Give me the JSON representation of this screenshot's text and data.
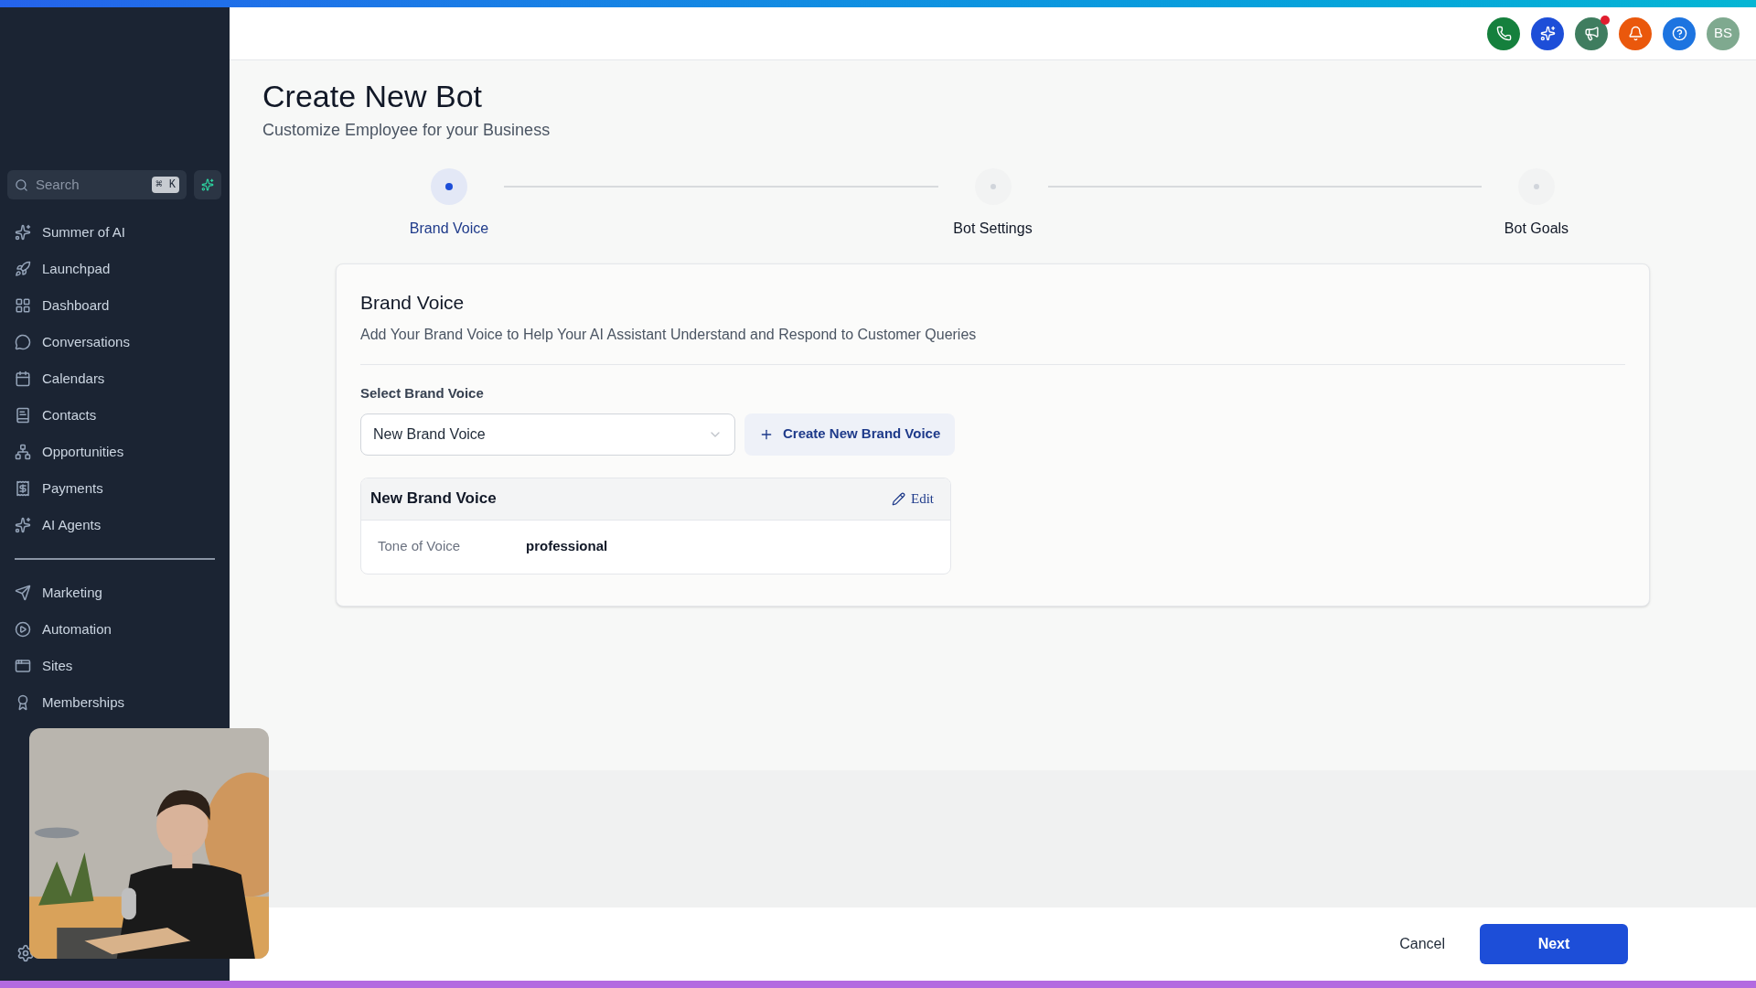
{
  "sidebar": {
    "search": {
      "placeholder": "Search",
      "shortcut": "⌘ K"
    },
    "items": [
      {
        "label": "Summer of AI",
        "kind": "sparkle"
      },
      {
        "label": "Launchpad",
        "kind": "rocket"
      },
      {
        "label": "Dashboard",
        "kind": "grid"
      },
      {
        "label": "Conversations",
        "kind": "chat"
      },
      {
        "label": "Calendars",
        "kind": "calendar"
      },
      {
        "label": "Contacts",
        "kind": "book"
      },
      {
        "label": "Opportunities",
        "kind": "network"
      },
      {
        "label": "Payments",
        "kind": "receipt"
      },
      {
        "label": "AI Agents",
        "kind": "sparkle"
      }
    ],
    "items_lower": [
      {
        "label": "Marketing",
        "kind": "send"
      },
      {
        "label": "Automation",
        "kind": "play"
      },
      {
        "label": "Sites",
        "kind": "site"
      },
      {
        "label": "Memberships",
        "kind": "award"
      }
    ]
  },
  "header": {
    "buttons": [
      {
        "kind": "phone",
        "color": "#15803d",
        "dot": false
      },
      {
        "kind": "sparkles",
        "color": "#1d4ed8",
        "dot": false
      },
      {
        "kind": "megaphone",
        "color": "#3f7d5f",
        "dot": true
      },
      {
        "kind": "bell",
        "color": "#ea580c",
        "dot": false
      },
      {
        "kind": "help",
        "color": "#1d74e0",
        "dot": false
      }
    ],
    "avatar": "BS"
  },
  "page": {
    "title": "Create New Bot",
    "subtitle": "Customize Employee for your Business"
  },
  "steps": [
    {
      "label": "Brand Voice",
      "selected": true
    },
    {
      "label": "Bot Settings",
      "selected": false
    },
    {
      "label": "Bot Goals",
      "selected": false
    }
  ],
  "card": {
    "title": "Brand Voice",
    "description": "Add Your Brand Voice to Help Your AI Assistant Understand and Respond to Customer Queries",
    "select_label": "Select Brand Voice",
    "select_value": "New Brand Voice",
    "create_button": "Create New Brand Voice",
    "voice": {
      "name": "New Brand Voice",
      "edit": "Edit",
      "fields": [
        {
          "label": "Tone of Voice",
          "value": "professional"
        }
      ]
    }
  },
  "footer": {
    "cancel": "Cancel",
    "next": "Next"
  }
}
